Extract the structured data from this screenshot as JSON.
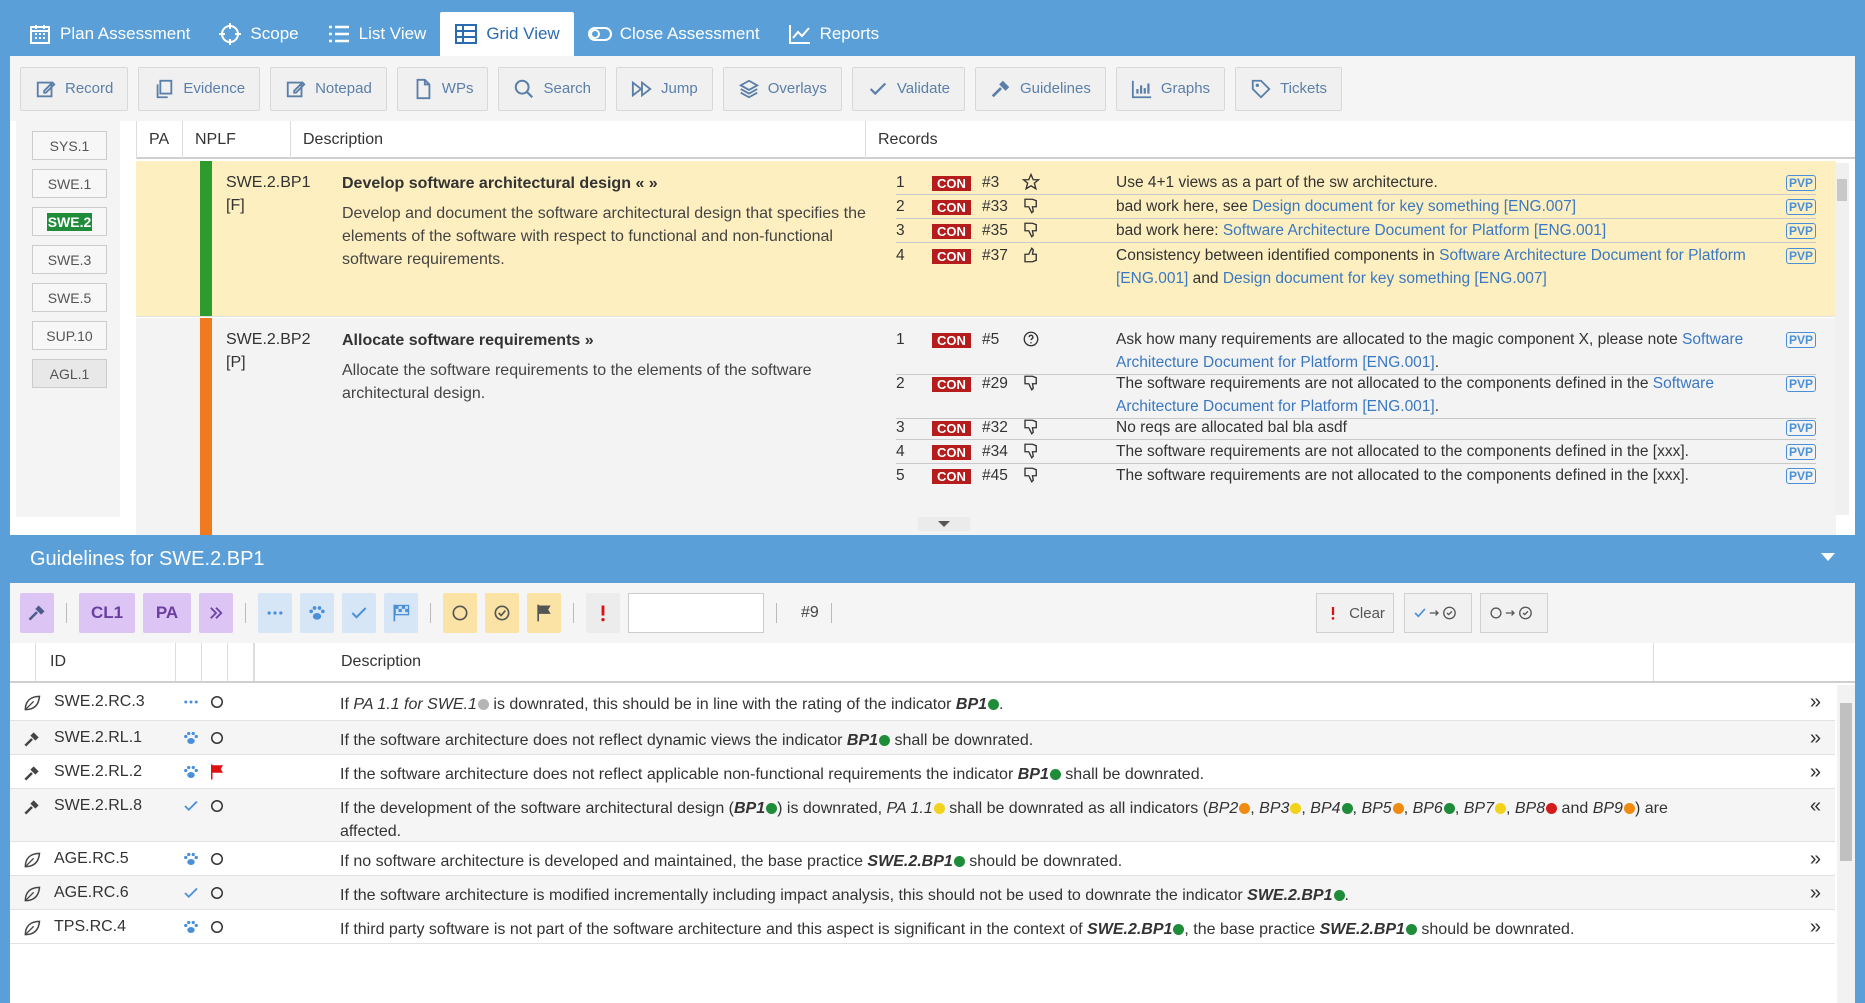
{
  "topnav": {
    "tabs": [
      {
        "label": "Plan Assessment",
        "icon": "calendar-icon",
        "active": false
      },
      {
        "label": "Scope",
        "icon": "crosshair-icon",
        "active": false
      },
      {
        "label": "List View",
        "icon": "list-icon",
        "active": false
      },
      {
        "label": "Grid View",
        "icon": "grid-icon",
        "active": true
      },
      {
        "label": "Close Assessment",
        "icon": "toggle-icon",
        "active": false
      },
      {
        "label": "Reports",
        "icon": "chart-line-icon",
        "active": false
      }
    ]
  },
  "toolbar": {
    "buttons": [
      "Record",
      "Evidence",
      "Notepad",
      "WPs",
      "Search",
      "Jump",
      "Overlays",
      "Validate",
      "Guidelines",
      "Graphs",
      "Tickets"
    ]
  },
  "processes": [
    "SYS.1",
    "SWE.1",
    "SWE.2",
    "SWE.3",
    "SWE.5",
    "SUP.10",
    "AGL.1"
  ],
  "active_process": "SWE.2",
  "grid": {
    "headers": {
      "pa": "PA",
      "nplf": "NPLF",
      "description": "Description",
      "records": "Records"
    },
    "bp1": {
      "id": "SWE.2.BP1",
      "rating": "[F]",
      "bar_color": "#2e9b2e",
      "title": "Develop software architectural design",
      "title_suffix": "« »",
      "desc": "Develop and document the software architectural design that specifies the elements of the software with respect to functional and non-functional software requirements.",
      "records": [
        {
          "n": "1",
          "tag": "CON",
          "rid": "#3",
          "icon": "star-icon",
          "pre": "Use 4+1 views as a part of the sw architecture.",
          "link1": "",
          "mid": "",
          "link2": "",
          "post": "",
          "badge": "PVP"
        },
        {
          "n": "2",
          "tag": "CON",
          "rid": "#33",
          "icon": "thumbs-down-icon",
          "pre": "bad work here, see ",
          "link1": "Design document for key something [ENG.007]",
          "mid": "",
          "link2": "",
          "post": "",
          "badge": "PVP"
        },
        {
          "n": "3",
          "tag": "CON",
          "rid": "#35",
          "icon": "thumbs-down-icon",
          "pre": "bad work here: ",
          "link1": "Software Architecture Document for Platform [ENG.001]",
          "mid": "",
          "link2": "",
          "post": "",
          "badge": "PVP"
        },
        {
          "n": "4",
          "tag": "CON",
          "rid": "#37",
          "icon": "thumbs-up-icon",
          "pre": "Consistency between identified components in ",
          "link1": "Software Architecture Document for Platform [ENG.001]",
          "mid": " and ",
          "link2": "Design document for key something [ENG.007]",
          "post": "",
          "badge": "PVP"
        }
      ]
    },
    "bp2": {
      "id": "SWE.2.BP2",
      "rating": "[P]",
      "bar_color": "#f07a20",
      "title": "Allocate software requirements",
      "title_suffix": "»",
      "desc": "Allocate the software requirements to the elements of the software architectural design.",
      "records": [
        {
          "n": "1",
          "tag": "CON",
          "rid": "#5",
          "icon": "question-icon",
          "pre": "Ask how many requirements are allocated to the magic component X, please note  ",
          "link1": "Software Architecture Document for Platform [ENG.001]",
          "mid": "",
          "link2": "",
          "post": ".",
          "badge": "PVP"
        },
        {
          "n": "2",
          "tag": "CON",
          "rid": "#29",
          "icon": "thumbs-down-icon",
          "pre": "The software requirements are not allocated to the components defined in the  ",
          "link1": "Software Architecture Document for Platform [ENG.001]",
          "mid": "",
          "link2": "",
          "post": ".",
          "badge": "PVP"
        },
        {
          "n": "3",
          "tag": "CON",
          "rid": "#32",
          "icon": "thumbs-down-icon",
          "pre": "No reqs are allocated bal bla asdf",
          "link1": "",
          "mid": "",
          "link2": "",
          "post": "",
          "badge": "PVP"
        },
        {
          "n": "4",
          "tag": "CON",
          "rid": "#34",
          "icon": "thumbs-down-icon",
          "pre": "The software requirements are not allocated to the components defined in the  [xxx].",
          "link1": "",
          "mid": "",
          "link2": "",
          "post": "",
          "badge": "PVP"
        },
        {
          "n": "5",
          "tag": "CON",
          "rid": "#45",
          "icon": "thumbs-down-icon",
          "pre": "The software requirements are not allocated to the components defined in the  [xxx].",
          "link1": "",
          "mid": "",
          "link2": "",
          "post": "",
          "badge": "PVP"
        }
      ]
    }
  },
  "guidelines": {
    "title": "Guidelines for SWE.2.BP1",
    "filters": {
      "cl1": "CL1",
      "pa": "PA",
      "count": "#9",
      "clear": "Clear",
      "input_value": ""
    },
    "headers": {
      "id": "ID",
      "description": "Description"
    },
    "rows": [
      {
        "icon": "leaf-icon",
        "id": "SWE.2.RC.3",
        "type": "dots-icon",
        "status": "circle-icon",
        "expand": "»"
      },
      {
        "icon": "hammer-icon",
        "id": "SWE.2.RL.1",
        "type": "paw-icon",
        "status": "circle-icon",
        "expand": "»"
      },
      {
        "icon": "hammer-icon",
        "id": "SWE.2.RL.2",
        "type": "paw-icon",
        "status": "red-flag-icon",
        "expand": "»"
      },
      {
        "icon": "hammer-icon",
        "id": "SWE.2.RL.8",
        "type": "check-icon",
        "status": "circle-icon",
        "expand": "«"
      },
      {
        "icon": "leaf-icon",
        "id": "AGE.RC.5",
        "type": "paw-icon",
        "status": "circle-icon",
        "expand": "»"
      },
      {
        "icon": "leaf-icon",
        "id": "AGE.RC.6",
        "type": "check-icon",
        "status": "circle-icon",
        "expand": "»"
      },
      {
        "icon": "leaf-icon",
        "id": "TPS.RC.4",
        "type": "paw-icon",
        "status": "circle-icon",
        "expand": "»"
      }
    ],
    "text": {
      "r0": [
        "If ",
        "PA 1.1 for SWE.1",
        " is downrated, this should be in line with the rating of the indicator ",
        "BP1",
        "."
      ],
      "r1": [
        "If the software architecture does not reflect dynamic views the indicator ",
        "BP1",
        " shall be downrated."
      ],
      "r2": [
        "If the software architecture does not reflect applicable non-functional requirements the indicator ",
        "BP1",
        " shall be downrated."
      ],
      "r3": [
        "If the development of the software architectural design (",
        "BP1",
        ") is downrated, ",
        "PA 1.1",
        " shall be downrated as all indicators (",
        "BP2",
        ", ",
        "BP3",
        ", ",
        "BP4",
        ", ",
        "BP5",
        ", ",
        "BP6",
        ", ",
        "BP7",
        ", ",
        "BP8",
        " and ",
        "BP9",
        ") are affected."
      ],
      "r4": [
        "If no software architecture is developed and maintained, the base practice ",
        "SWE.2.BP1",
        " should be downrated."
      ],
      "r5": [
        "If the software architecture is modified incrementally including impact analysis, this should not be used to downrate the indicator ",
        "SWE.2.BP1",
        "."
      ],
      "r6": [
        "If third party software is not part of the software architecture and this aspect is significant in the context of ",
        "SWE.2.BP1",
        ", the base practice ",
        "SWE.2.BP1",
        " should be downrated."
      ]
    }
  },
  "colors": {
    "accent": "#5a9fd8",
    "con": "#b51d1d",
    "green": "#1f8c3a",
    "orange": "#f08a10",
    "yellow": "#f2d21a",
    "red": "#d51c1c",
    "gray": "#b5b5b5"
  }
}
